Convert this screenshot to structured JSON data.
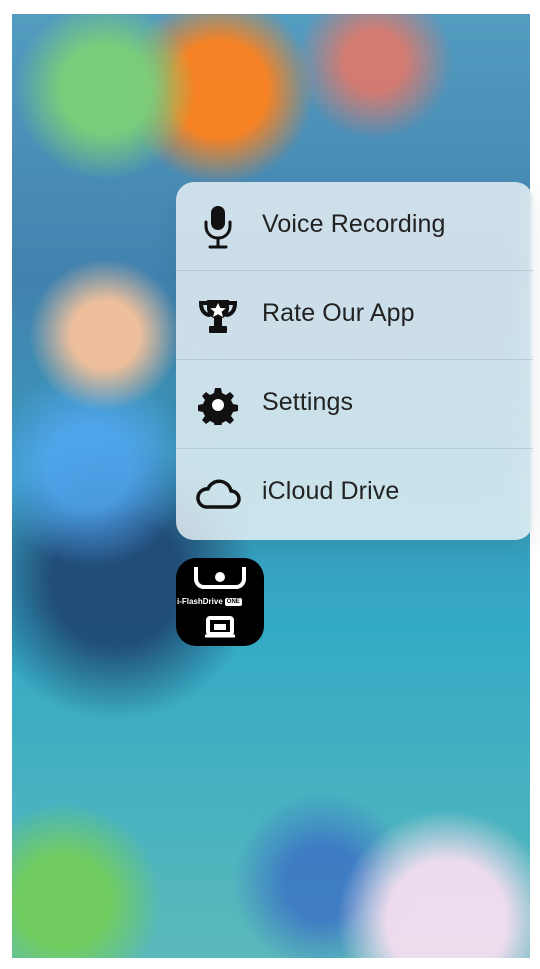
{
  "menu": {
    "items": [
      {
        "label": "Voice Recording",
        "icon": "microphone-icon"
      },
      {
        "label": "Rate Our App",
        "icon": "trophy-star-icon"
      },
      {
        "label": "Settings",
        "icon": "gear-icon"
      },
      {
        "label": "iCloud Drive",
        "icon": "cloud-icon"
      }
    ]
  },
  "app": {
    "name": "i-FlashDrive",
    "badge": "ONE",
    "icon": "i-flashdrive-one-app-icon"
  },
  "colors": {
    "menu_background": "#f3f7f8",
    "text": "#222222",
    "app_icon_background": "#000000",
    "wallpaper_blue": "#3b7ba7",
    "wallpaper_teal": "#31a6c1"
  }
}
